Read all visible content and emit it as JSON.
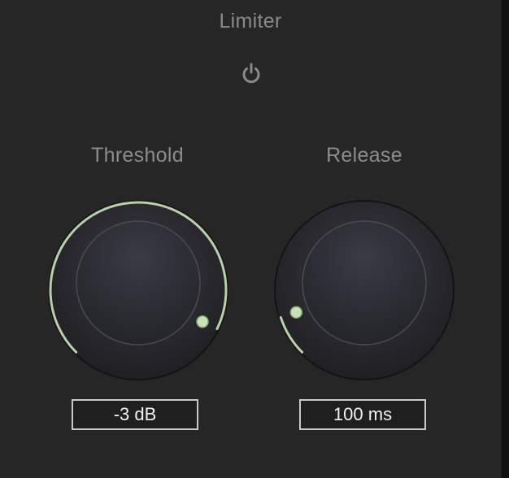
{
  "plugin": {
    "title": "Limiter",
    "power_icon": "power-icon",
    "accent_color": "#c8e6b8"
  },
  "threshold": {
    "label": "Threshold",
    "value_text": "-3 dB",
    "level": 0.93
  },
  "release": {
    "label": "Release",
    "value_text": "100 ms",
    "level": 0.1
  }
}
